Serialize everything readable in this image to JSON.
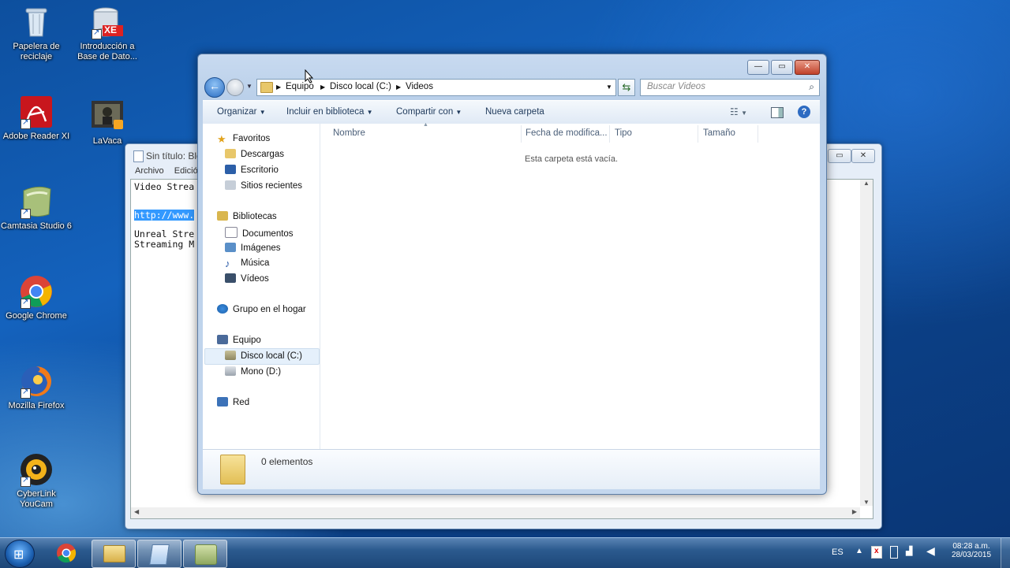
{
  "desktop": {
    "icons": [
      {
        "label": "Papelera de reciclaje"
      },
      {
        "label": "Introducción a Base de Dato..."
      },
      {
        "label": "Adobe Reader XI"
      },
      {
        "label": "LaVaca"
      },
      {
        "label": "Camtasia Studio 6"
      },
      {
        "label": "Google Chrome"
      },
      {
        "label": "Mozilla Firefox"
      },
      {
        "label": "CyberLink YouCam"
      }
    ],
    "icon_badge": "XE"
  },
  "notepad": {
    "title": "Sin título: Blo",
    "menu": [
      "Archivo",
      "Edició"
    ],
    "lines": [
      "Video Strea",
      "http://www.",
      "Unreal Stre",
      "Streaming M"
    ]
  },
  "explorer": {
    "breadcrumb": [
      "Equipo",
      "Disco local (C:)",
      "Videos"
    ],
    "search_placeholder": "Buscar Videos",
    "toolbar": {
      "organize": "Organizar",
      "include": "Incluir en biblioteca",
      "share": "Compartir con",
      "new_folder": "Nueva carpeta"
    },
    "nav": {
      "favorites": "Favoritos",
      "downloads": "Descargas",
      "desktop": "Escritorio",
      "recent": "Sitios recientes",
      "libraries": "Bibliotecas",
      "documents": "Documentos",
      "images": "Imágenes",
      "music": "Música",
      "videos": "Vídeos",
      "homegroup": "Grupo en el hogar",
      "computer": "Equipo",
      "local_disk": "Disco local (C:)",
      "mono": "Mono (D:)",
      "network": "Red"
    },
    "columns": [
      "Nombre",
      "Fecha de modifica...",
      "Tipo",
      "Tamaño"
    ],
    "empty_message": "Esta carpeta está vacía.",
    "status": "0 elementos"
  },
  "taskbar": {
    "lang": "ES",
    "time": "08:28 a.m.",
    "date": "28/03/2015"
  }
}
